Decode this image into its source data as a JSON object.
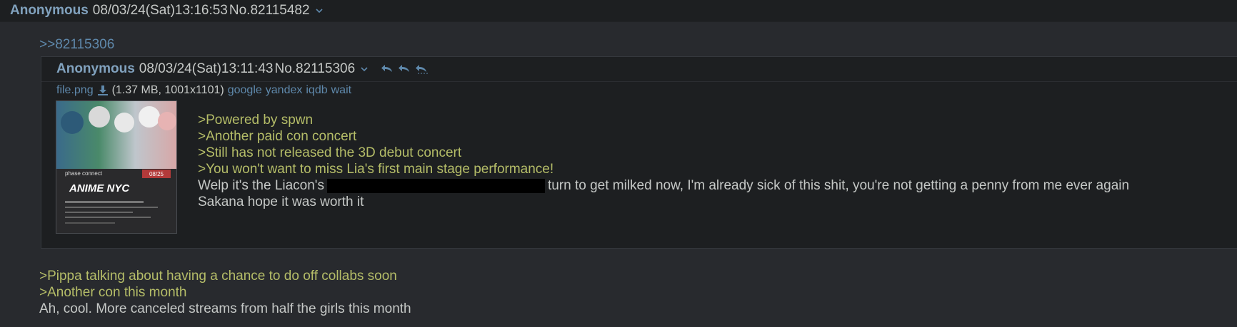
{
  "post": {
    "name": "Anonymous",
    "datetime": "08/03/24(Sat)13:16:53",
    "number": "No.82115482",
    "quote_link": ">>82115306",
    "greentext": [
      ">Pippa talking about having a chance to do off collabs soon",
      ">Another con this month"
    ],
    "text": "Ah, cool. More canceled streams from half the girls this month"
  },
  "inline_post": {
    "name": "Anonymous",
    "datetime": "08/03/24(Sat)13:11:43",
    "number": "No.82115306",
    "file": {
      "name": "file.png",
      "meta": "(1.37 MB, 1001x1101)",
      "links": [
        "google",
        "yandex",
        "iqdb",
        "wait"
      ]
    },
    "greentext": [
      ">Powered by spwn",
      ">Another paid con concert",
      ">Still has not released the 3D debut concert",
      ">You won't want to miss Lia's first main stage performance!"
    ],
    "line_before_spoiler": "Welp it's the Liacon's",
    "line_after_spoiler": "turn to get milked now, I'm already sick of this shit, you're not getting a penny from me ever again",
    "last_line": "Sakana hope it was worth it",
    "thumbnail": {
      "brand": "phase connect",
      "logo": "ANIME NYC",
      "date_badge": "08/25"
    }
  },
  "colors": {
    "background": "#282a2e",
    "header": "#1d1f21",
    "name": "#81a2be",
    "link": "#5f89ac",
    "greentext": "#b5bd68",
    "text": "#c5c8c6"
  }
}
